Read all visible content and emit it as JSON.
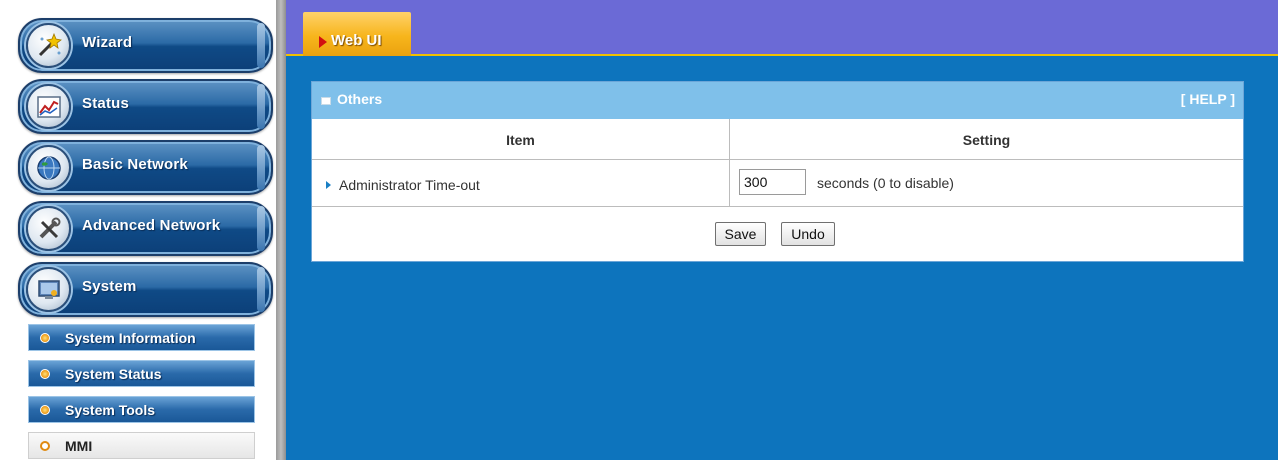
{
  "sidebar": {
    "menu": [
      {
        "label": "Wizard",
        "icon": "wand-icon"
      },
      {
        "label": "Status",
        "icon": "chart-icon"
      },
      {
        "label": "Basic Network",
        "icon": "globe-icon"
      },
      {
        "label": "Advanced Network",
        "icon": "tools-icon"
      },
      {
        "label": "System",
        "icon": "monitor-icon"
      }
    ],
    "submenu": [
      {
        "label": "System Information"
      },
      {
        "label": "System Status"
      },
      {
        "label": "System Tools"
      },
      {
        "label": "MMI",
        "active": true
      }
    ]
  },
  "topbar": {
    "tab_label": "Web UI"
  },
  "panel": {
    "title": "Others",
    "help_label": "[ HELP ]",
    "columns": [
      "Item",
      "Setting"
    ],
    "rows": [
      {
        "item": "Administrator Time-out",
        "value": "300",
        "unit_text": "seconds (0 to disable)"
      }
    ],
    "save_label": "Save",
    "undo_label": "Undo"
  },
  "colors": {
    "main_bg": "#0d74bd",
    "topbar_bg": "#6b6ad6",
    "tab_bg": "#f7b51c",
    "panel_header_bg": "#7fc0ea",
    "accent_line": "#f0c000"
  }
}
